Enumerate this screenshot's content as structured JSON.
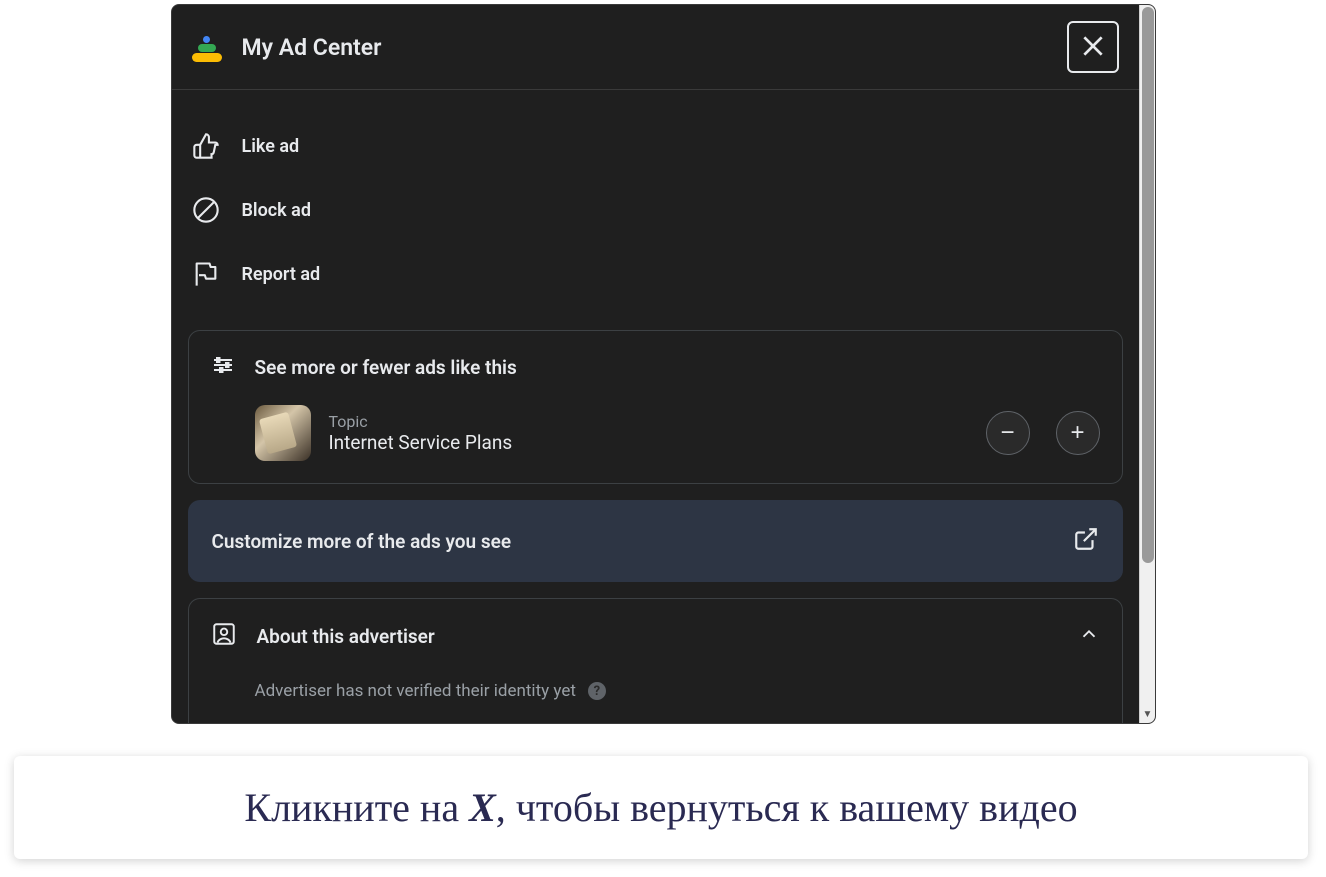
{
  "header": {
    "title": "My Ad Center"
  },
  "actions": {
    "like": "Like ad",
    "block": "Block ad",
    "report": "Report ad"
  },
  "adsCard": {
    "title": "See more or fewer ads like this",
    "topic_label": "Topic",
    "topic_value": "Internet Service Plans"
  },
  "customize": {
    "text": "Customize more of the ads you see"
  },
  "advertiser": {
    "title": "About this advertiser",
    "sub": "Advertiser has not verified their identity yet"
  },
  "caption": {
    "pre": "Кликните на ",
    "x": "X",
    "post": ", чтобы вернуться к вашему видео"
  }
}
